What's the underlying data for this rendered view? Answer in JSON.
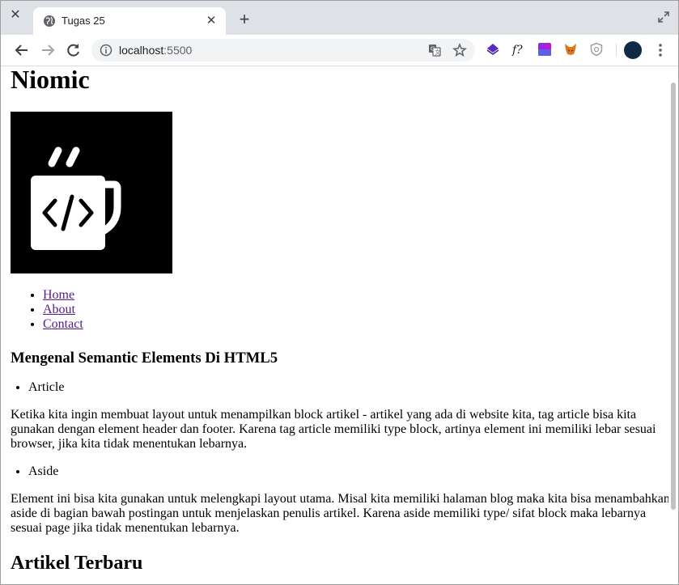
{
  "browser": {
    "tab_title": "Tugas 25",
    "url_host": "localhost",
    "url_port": ":5500",
    "icons": [
      "close-icon",
      "globe-icon",
      "plus-icon",
      "maximize-icon",
      "back-icon",
      "forward-icon",
      "reload-icon",
      "info-icon",
      "translate-icon",
      "star-icon",
      "stack-extension-icon",
      "function-extension-icon",
      "gradient-extension-icon",
      "fox-extension-icon",
      "shield-extension-icon",
      "avatar",
      "kebab-menu-icon"
    ]
  },
  "page": {
    "site_title": "Niomic",
    "nav": [
      "Home",
      "About",
      "Contact"
    ],
    "article_title": "Mengenal Semantic Elements Di HTML5",
    "sections": [
      {
        "label": "Article",
        "text": "Ketika kita ingin membuat layout untuk menampilkan block artikel - artikel yang ada di website kita, tag article bisa kita gunakan dengan element header dan footer. Karena tag article memiliki type block, artinya element ini memiliki lebar sesuai browser, jika kita tidak menentukan lebarnya."
      },
      {
        "label": "Aside",
        "text": "Element ini bisa kita gunakan untuk melengkapi layout utama. Misal kita memiliki halaman blog maka kita bisa menambahkan aside di bagian bawah postingan untuk menjelaskan penulis artikel. Karena aside memiliki type/ sifat block maka lebarnya sesuai page jika tidak menentukan lebarnya."
      }
    ],
    "latest_heading": "Artikel Terbaru"
  },
  "colors": {
    "tabstrip": "#dee1e6",
    "link_visited": "#551a8b",
    "omnibox": "#f1f3f4"
  }
}
